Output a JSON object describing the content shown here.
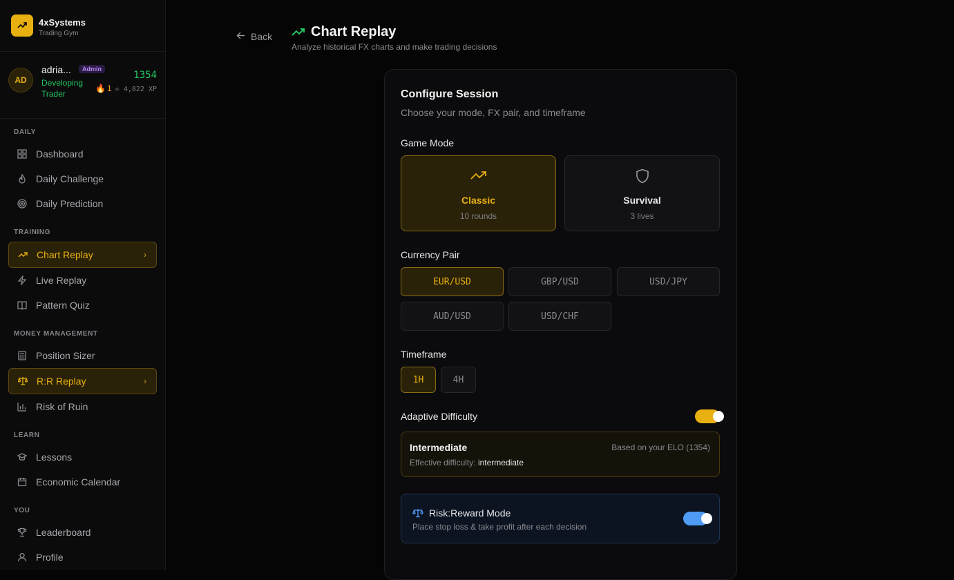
{
  "brand": {
    "name": "4xSystems",
    "subtitle": "Trading Gym"
  },
  "user": {
    "initials": "AD",
    "name": "adria...",
    "badge": "Admin",
    "rank": "Developing Trader",
    "elo": "1354",
    "streak": "1",
    "xp": "4,822 XP"
  },
  "nav": {
    "daily_label": "DAILY",
    "daily": [
      {
        "label": "Dashboard",
        "icon": "grid-icon"
      },
      {
        "label": "Daily Challenge",
        "icon": "flame-icon"
      },
      {
        "label": "Daily Prediction",
        "icon": "target-icon"
      }
    ],
    "training_label": "TRAINING",
    "training": [
      {
        "label": "Chart Replay",
        "icon": "trending-up-icon",
        "active": true
      },
      {
        "label": "Live Replay",
        "icon": "bolt-icon"
      },
      {
        "label": "Pattern Quiz",
        "icon": "book-icon"
      }
    ],
    "money_label": "MONEY MANAGEMENT",
    "money": [
      {
        "label": "Position Sizer",
        "icon": "calculator-icon"
      },
      {
        "label": "R:R Replay",
        "icon": "scale-icon",
        "active": true
      },
      {
        "label": "Risk of Ruin",
        "icon": "bar-chart-icon"
      }
    ],
    "learn_label": "LEARN",
    "learn": [
      {
        "label": "Lessons",
        "icon": "graduation-cap-icon"
      },
      {
        "label": "Economic Calendar",
        "icon": "calendar-icon"
      }
    ],
    "you_label": "YOU",
    "you": [
      {
        "label": "Leaderboard",
        "icon": "trophy-icon"
      },
      {
        "label": "Profile",
        "icon": "user-icon"
      }
    ]
  },
  "header": {
    "back_label": "Back",
    "title": "Chart Replay",
    "subtitle": "Analyze historical FX charts and make trading decisions"
  },
  "config": {
    "title": "Configure Session",
    "subtitle": "Choose your mode, FX pair, and timeframe",
    "game_mode_label": "Game Mode",
    "modes": [
      {
        "name": "Classic",
        "sub": "10 rounds",
        "selected": true
      },
      {
        "name": "Survival",
        "sub": "3 lives",
        "selected": false
      }
    ],
    "pair_label": "Currency Pair",
    "pairs": [
      {
        "label": "EUR/USD",
        "selected": true
      },
      {
        "label": "GBP/USD",
        "selected": false
      },
      {
        "label": "USD/JPY",
        "selected": false
      },
      {
        "label": "AUD/USD",
        "selected": false
      },
      {
        "label": "USD/CHF",
        "selected": false
      }
    ],
    "timeframe_label": "Timeframe",
    "timeframes": [
      {
        "label": "1H",
        "selected": true
      },
      {
        "label": "4H",
        "selected": false
      }
    ],
    "adaptive_label": "Adaptive Difficulty",
    "adaptive_on": true,
    "difficulty": {
      "title": "Intermediate",
      "elo_note": "Based on your ELO (1354)",
      "effective_label": "Effective difficulty:",
      "effective_value": "intermediate"
    },
    "rr": {
      "title": "Risk:Reward Mode",
      "subtitle": "Place stop loss & take profit after each decision",
      "on": true
    }
  },
  "colors": {
    "accent": "#e8b011",
    "green": "#22c55e",
    "blue": "#4f9cf5"
  }
}
